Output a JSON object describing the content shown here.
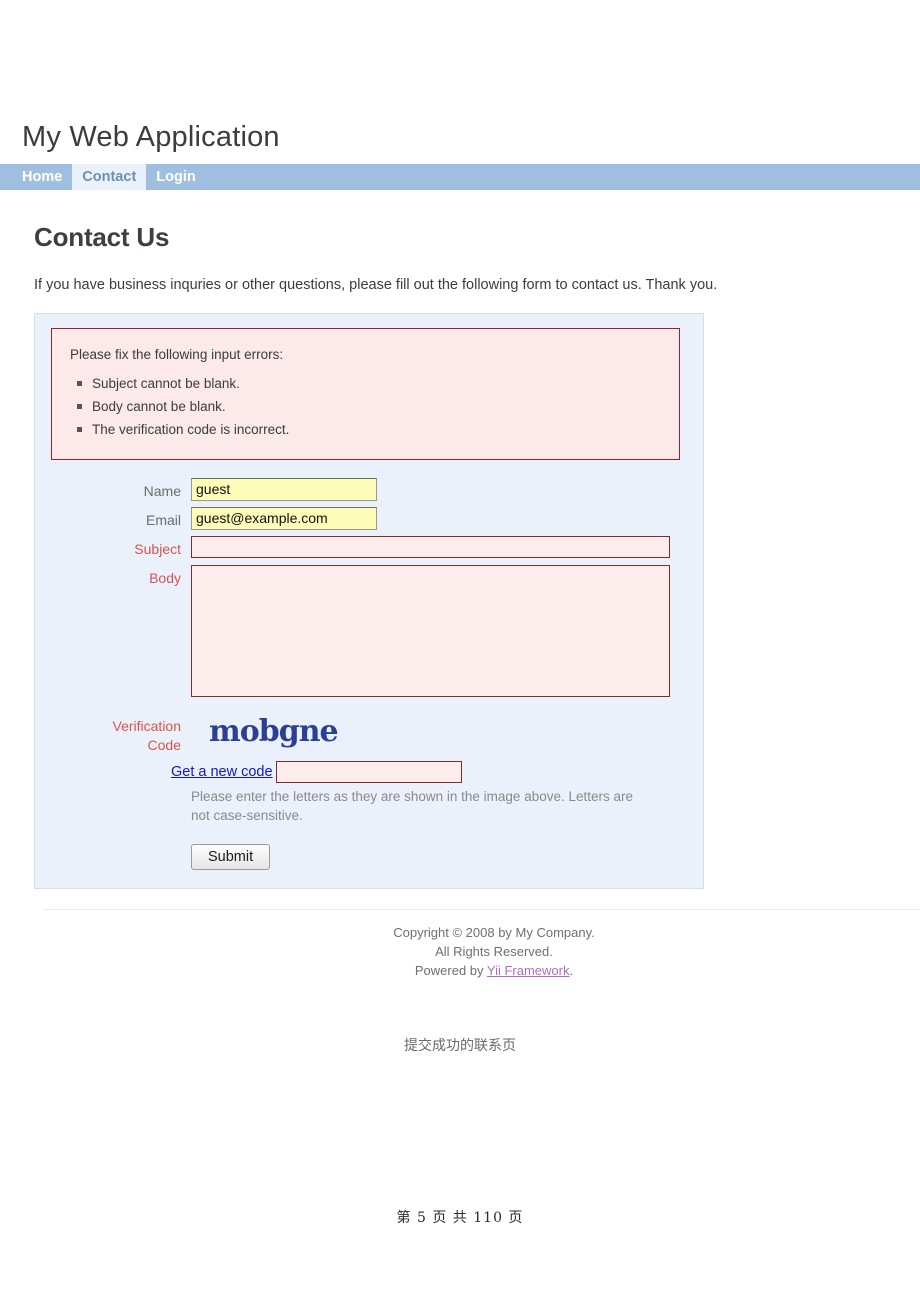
{
  "site": {
    "title": "My Web Application"
  },
  "nav": {
    "items": [
      {
        "label": "Home",
        "active": false
      },
      {
        "label": "Contact",
        "active": true
      },
      {
        "label": "Login",
        "active": false
      }
    ]
  },
  "content": {
    "heading": "Contact Us",
    "intro": "If you have business inquries or other questions, please fill out the following form to contact us. Thank you."
  },
  "errors": {
    "title": "Please fix the following input errors:",
    "items": [
      "Subject cannot be blank.",
      "Body cannot be blank.",
      "The verification code is incorrect."
    ]
  },
  "form": {
    "name": {
      "label": "Name",
      "value": "guest",
      "state": "ok"
    },
    "email": {
      "label": "Email",
      "value": "guest@example.com",
      "state": "ok"
    },
    "subject": {
      "label": "Subject",
      "value": "",
      "state": "error"
    },
    "body": {
      "label": "Body",
      "value": "",
      "state": "error"
    },
    "verification": {
      "label_line1": "Verification",
      "label_line2": "Code",
      "captcha_text": "mobgne",
      "refresh_label": "Get a new code",
      "value": "",
      "state": "error",
      "hint": "Please enter the letters as they are shown in the image above. Letters are not case-sensitive."
    },
    "submit_label": "Submit"
  },
  "footer": {
    "line1": "Copyright © 2008 by My Company.",
    "line2": "All Rights Reserved.",
    "powered_prefix": "Powered by ",
    "powered_link": "Yii Framework",
    "powered_suffix": "."
  },
  "scan": {
    "caption": "提交成功的联系页",
    "page_number": "第 5 页 共 110 页"
  },
  "colors": {
    "nav_bg": "#9fbfe0",
    "nav_active_bg": "#e9f2fb",
    "panel_bg": "#eaf1fa",
    "panel_border": "#cfe0ef",
    "error_border": "#9b2525",
    "error_bg": "#fce9e9",
    "error_label": "#d9534f",
    "valid_field_bg": "#fdfdb9",
    "captcha_color": "#2b3f94",
    "link_color": "#1616c8",
    "footer_link": "#b06cc0"
  }
}
